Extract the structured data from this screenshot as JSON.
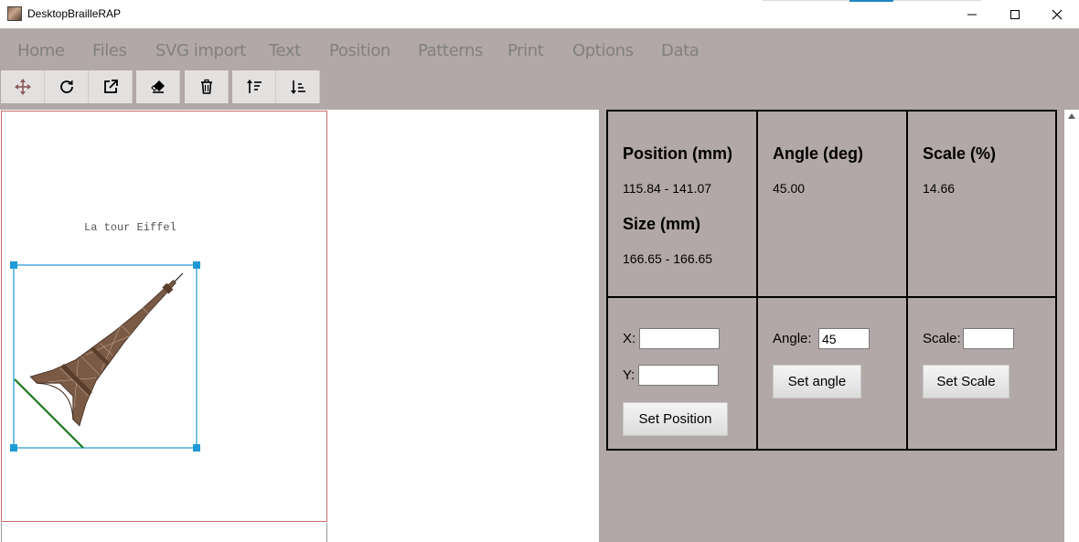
{
  "window": {
    "title": "DesktopBrailleRAP",
    "minimize_icon": "minimize-icon",
    "maximize_icon": "maximize-icon",
    "close_icon": "close-icon"
  },
  "menu": {
    "items": [
      "Home",
      "Files",
      "SVG import",
      "Text",
      "Position",
      "Patterns",
      "Print",
      "Options",
      "Data"
    ]
  },
  "toolbar": {
    "buttons": [
      {
        "icon": "move-icon"
      },
      {
        "icon": "rotate-icon"
      },
      {
        "icon": "external-link-icon"
      },
      {
        "icon": "eraser-icon"
      },
      {
        "icon": "trash-icon"
      },
      {
        "icon": "sort-ascending-icon"
      },
      {
        "icon": "sort-descending-icon"
      }
    ],
    "accent_color": "#8a5a5a"
  },
  "canvas": {
    "page_text": "La tour Eiffel",
    "selection_color": "#1e9ad6",
    "baseline_color": "#1a7a1a"
  },
  "info": {
    "position_heading": "Position (mm)",
    "position_value": "115.84 - 141.07",
    "size_heading": "Size (mm)",
    "size_value": "166.65 - 166.65",
    "angle_heading": "Angle (deg)",
    "angle_value": "45.00",
    "scale_heading": "Scale (%)",
    "scale_value": "14.66"
  },
  "controls": {
    "x_label": "X:",
    "x_value": "",
    "y_label": "Y:",
    "y_value": "",
    "set_position_label": "Set Position",
    "angle_label": "Angle:",
    "angle_value": "45",
    "set_angle_label": "Set angle",
    "scale_label": "Scale:",
    "scale_value": "",
    "set_scale_label": "Set Scale"
  },
  "colors": {
    "panel_bg": "#b2a8a7",
    "menu_text": "#808080"
  }
}
